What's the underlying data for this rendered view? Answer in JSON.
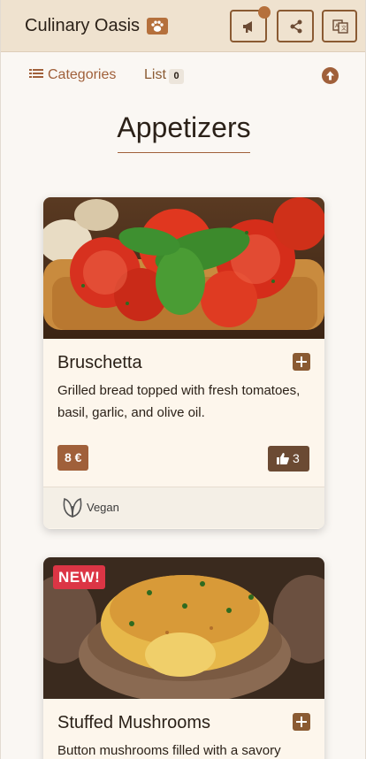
{
  "header": {
    "brand": "Culinary Oasis",
    "buttons": {
      "announce_icon": "megaphone-icon",
      "share_icon": "share-icon",
      "language_icon": "language-icon"
    }
  },
  "nav": {
    "categories_label": "Categories",
    "list_label": "List",
    "list_count": "0"
  },
  "page": {
    "title": "Appetizers"
  },
  "items": [
    {
      "name": "Bruschetta",
      "description": "Grilled bread topped with fresh tomatoes, basil, garlic, and olive oil.",
      "price": "8 €",
      "likes": "3",
      "tag": "Vegan",
      "image": "bruschetta-photo"
    },
    {
      "name": "Stuffed Mushrooms",
      "description": "Button mushrooms filled with a savory",
      "badge": "NEW!",
      "image": "stuffed-mushrooms-photo"
    }
  ],
  "colors": {
    "accent": "#a0603a",
    "header_bg": "#efe2cf",
    "new_badge": "#dc3545",
    "likes_bg": "#6b4a33"
  }
}
